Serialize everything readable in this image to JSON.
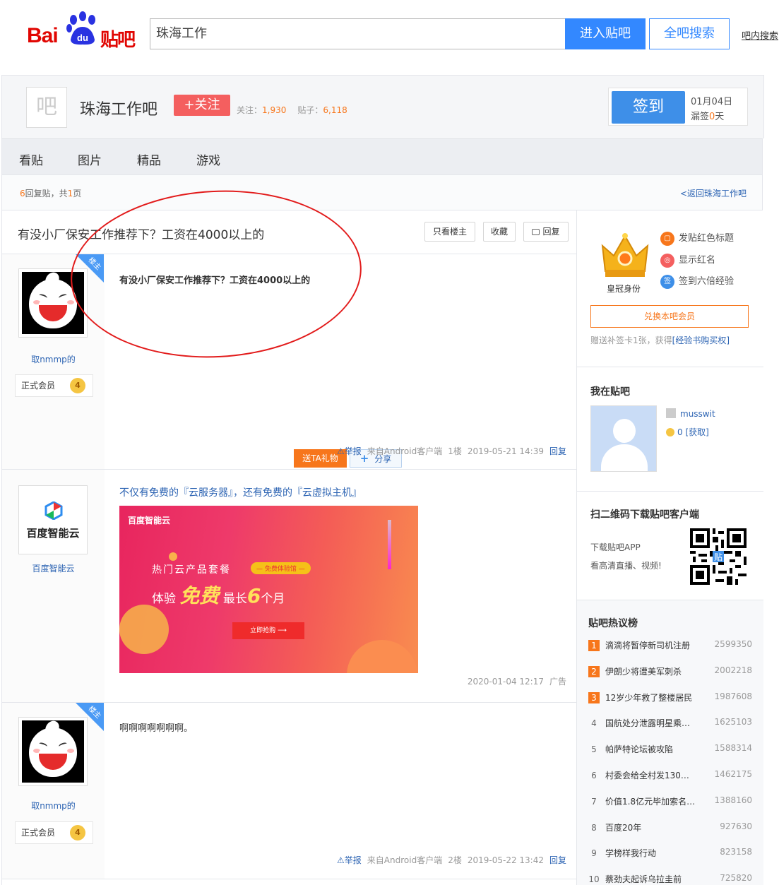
{
  "logo": {
    "bai": "Bai",
    "du": "du",
    "tieba": "贴吧"
  },
  "search": {
    "value": "珠海工作",
    "enter_label": "进入贴吧",
    "all_label": "全吧搜索",
    "in_bar_label": "吧内搜索"
  },
  "forum": {
    "avatar_char": "吧",
    "name": "珠海工作吧",
    "follow_label": "+关注",
    "followers_label": "关注：",
    "followers": "1,930",
    "posts_label": "贴子：",
    "posts": "6,118",
    "sign_label": "签到",
    "sign_date": "01月04日",
    "sign_miss_prefix": "漏签",
    "sign_miss_num": "0",
    "sign_miss_suffix": "天"
  },
  "nav": {
    "tabs": [
      "看贴",
      "图片",
      "精品",
      "游戏"
    ]
  },
  "pager": {
    "count": "6",
    "text": "回复贴，共",
    "pages": "1",
    "pages_suffix": "页",
    "back_label": "<返回珠海工作吧"
  },
  "thread": {
    "title": "有没小厂保安工作推荐下？工资在4000以上的",
    "only_op_label": "只看楼主",
    "collect_label": "收藏",
    "reply_label": "回复"
  },
  "posts": [
    {
      "op_tag": "楼主",
      "user": "取nmmp的",
      "member": "正式会员",
      "level": "4",
      "content": "有没小厂保安工作推荐下？工资在4000以上的",
      "gift_label": "送TA礼物",
      "share_label": "分享",
      "report": "举报",
      "source": "来自Android客户端",
      "floor": "1楼",
      "time": "2019-05-21 14:39",
      "reply": "回复"
    },
    {
      "op_tag": "楼主",
      "user": "取nmmp的",
      "member": "正式会员",
      "level": "4",
      "content": "啊啊啊啊啊啊啊。",
      "report": "举报",
      "source": "来自Android客户端",
      "floor": "2楼",
      "time": "2019-05-22 13:42",
      "reply": "回复"
    }
  ],
  "ad": {
    "logo_text": "百度智能云",
    "name": "百度智能云",
    "title": "不仅有免费的『云服务器』，还有免费的『云虚拟主机』",
    "banner_brand": "百度智能云",
    "banner_line1": "热门云产品套餐",
    "banner_tag": "— 免费体验馆 —",
    "banner_line2_a": "体验",
    "banner_line2_big": "免费",
    "banner_line2_b": "最长",
    "banner_line2_num": "6",
    "banner_line2_c": "个月",
    "banner_buy": "立即抢购 ⟶",
    "time": "2020-01-04 12:17",
    "ad_label": "广告"
  },
  "aside": {
    "crown_label": "皇冠身份",
    "perks": [
      "发贴红色标题",
      "显示红名",
      "签到六倍经验"
    ],
    "member_btn": "兑换本吧会员",
    "member_note_a": "赠送补签卡1张，获得",
    "member_note_link": "[经验书购买权]",
    "me_title": "我在贴吧",
    "me_name": "musswit",
    "me_coins": "0",
    "me_get": "[获取]",
    "qr_title": "扫二维码下载贴吧客户端",
    "qr_line1": "下载贴吧APP",
    "qr_line2": "看高清直播、视频!",
    "qr_badge": "贴",
    "hot_title": "贴吧热议榜",
    "hot": [
      {
        "rank": "1",
        "name": "滴滴将暂停新司机注册",
        "count": "2599350"
      },
      {
        "rank": "2",
        "name": "伊朗少将遭美军刺杀",
        "count": "2002218"
      },
      {
        "rank": "3",
        "name": "12岁少年救了整楼居民",
        "count": "1987608"
      },
      {
        "rank": "4",
        "name": "国航处分泄露明星乘…",
        "count": "1625103"
      },
      {
        "rank": "5",
        "name": "帕萨特论坛被攻陷",
        "count": "1588314"
      },
      {
        "rank": "6",
        "name": "村委会给全村发130…",
        "count": "1462175"
      },
      {
        "rank": "7",
        "name": "价值1.8亿元毕加索名…",
        "count": "1388160"
      },
      {
        "rank": "8",
        "name": "百度20年",
        "count": "927630"
      },
      {
        "rank": "9",
        "name": "学榜样我行动",
        "count": "823158"
      },
      {
        "rank": "10",
        "name": "蔡劲夫起诉乌拉圭前",
        "count": "725820"
      }
    ]
  },
  "colors": {
    "accent": "#3388ff",
    "orange": "#f7761b",
    "link": "#2d64b3",
    "follow": "#f45f5f",
    "annotation": "#e21b1b"
  }
}
